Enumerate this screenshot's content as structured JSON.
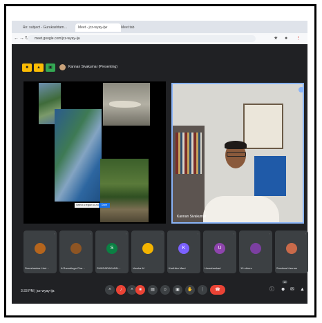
{
  "browser": {
    "tabs": [
      "Re: subject - Gurukashtam…",
      "Meet - jcz-wyay-ijw",
      "Meet tab"
    ],
    "url": "meet.google.com/jcz-wyay-ija"
  },
  "meeting": {
    "presenter_label": "Kannan Sivakumar (Presenting)",
    "caption_text": "Select a region to zoom",
    "caption_button": "Done",
    "video_name": "Kannan Sivakumar",
    "time_code": "3:33 PM  |  jcz-wyay-ija",
    "participants_badge": "10"
  },
  "participants": [
    {
      "name": "Sreeshankar Hari…",
      "initial": "",
      "color": "#b5651d"
    },
    {
      "name": "A Ramalinga Cha…",
      "initial": "",
      "color": "#8d5524"
    },
    {
      "name": "SUNDARAKANN…",
      "initial": "S",
      "color": "#0b8043"
    },
    {
      "name": "Varsha M",
      "initial": "",
      "color": "#f4b400"
    },
    {
      "name": "Karthika Mani",
      "initial": "K",
      "color": "#7b61ff"
    },
    {
      "name": "Umashankari",
      "initial": "U",
      "color": "#8e44ad"
    },
    {
      "name": "10 others",
      "initial": "",
      "color": "#7b3fa0"
    },
    {
      "name": "Sundara Kannan",
      "initial": "",
      "color": "#c96a4a"
    }
  ],
  "colors": {
    "meet_bg": "#202124",
    "accent": "#8ab4f8",
    "end_call": "#ea4335"
  }
}
